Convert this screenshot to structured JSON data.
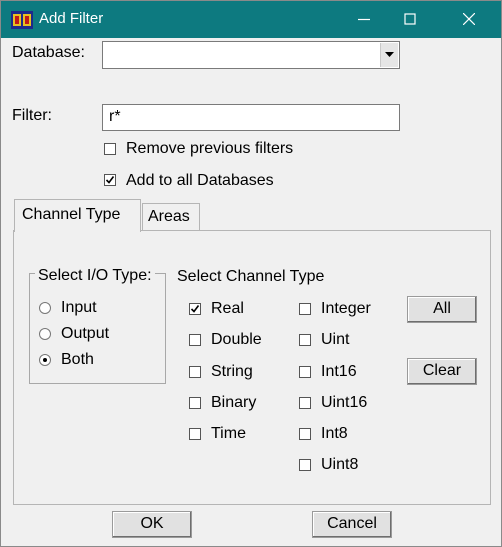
{
  "window": {
    "title": "Add Filter"
  },
  "titlebar_controls": {
    "minimize_icon": "minimize-icon",
    "maximize_icon": "maximize-icon",
    "close_icon": "close-icon"
  },
  "database": {
    "label": "Database:",
    "value": ""
  },
  "filter": {
    "label": "Filter:",
    "value": "r*"
  },
  "options": [
    {
      "label": "Remove previous filters",
      "checked": false
    },
    {
      "label": "Add to all Databases",
      "checked": true
    }
  ],
  "tabs": [
    {
      "label": "Channel Type",
      "active": true
    },
    {
      "label": "Areas",
      "active": false
    }
  ],
  "io_type": {
    "title": "Select I/O Type:",
    "options": [
      {
        "label": "Input",
        "selected": false
      },
      {
        "label": "Output",
        "selected": false
      },
      {
        "label": "Both",
        "selected": true
      }
    ]
  },
  "channel_type": {
    "title": "Select Channel Type",
    "col1": [
      {
        "label": "Real",
        "checked": true
      },
      {
        "label": "Double",
        "checked": false
      },
      {
        "label": "String",
        "checked": false
      },
      {
        "label": "Binary",
        "checked": false
      },
      {
        "label": "Time",
        "checked": false
      }
    ],
    "col2": [
      {
        "label": "Integer",
        "checked": false
      },
      {
        "label": "Uint",
        "checked": false
      },
      {
        "label": "Int16",
        "checked": false
      },
      {
        "label": "Uint16",
        "checked": false
      },
      {
        "label": "Int8",
        "checked": false
      },
      {
        "label": "Uint8",
        "checked": false
      }
    ],
    "all_label": "All",
    "clear_label": "Clear"
  },
  "footer": {
    "ok_label": "OK",
    "cancel_label": "Cancel"
  },
  "colors": {
    "titlebar": "#0d7a80",
    "window_bg": "#f0f0f0"
  }
}
